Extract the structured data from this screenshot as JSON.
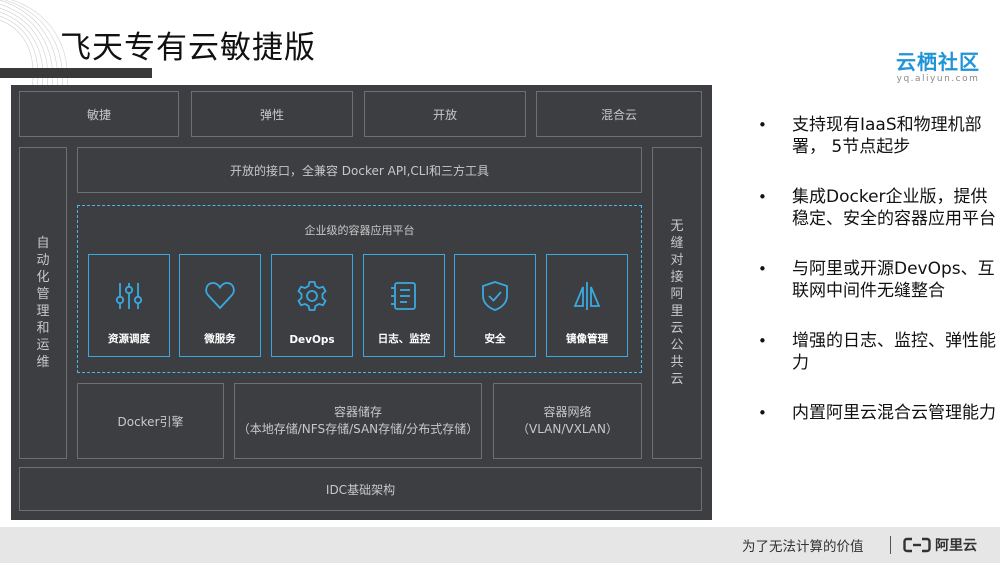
{
  "slide": {
    "title": "飞天专有云敏捷版",
    "logo_main": "云栖社区",
    "logo_sub": "yq.aliyun.com"
  },
  "diagram": {
    "top_row": [
      "敏捷",
      "弹性",
      "开放",
      "混合云"
    ],
    "left_side": "自动化管理和运维",
    "right_side": "无缝对接阿里云公共云",
    "api_bar": "开放的接口，全兼容 Docker API,CLI和三方工具",
    "platform": {
      "title": "企业级的容器应用平台",
      "modules": [
        {
          "label": "资源调度",
          "icon": "sliders-icon"
        },
        {
          "label": "微服务",
          "icon": "heart-icon"
        },
        {
          "label": "DevOps",
          "icon": "gear-icon"
        },
        {
          "label": "日志、监控",
          "icon": "log-icon"
        },
        {
          "label": "安全",
          "icon": "shield-icon"
        },
        {
          "label": "镜像管理",
          "icon": "mirror-icon"
        }
      ]
    },
    "engine": "Docker引擎",
    "storage_title": "容器储存",
    "storage_detail": "（本地存储/NFS存储/SAN存储/分布式存储）",
    "network_title": "容器网络",
    "network_detail": "（VLAN/VXLAN）",
    "base": "IDC基础架构"
  },
  "bullets": [
    "支持现有IaaS和物理机部署， 5节点起步",
    "集成Docker企业版，提供稳定、安全的容器应用平台",
    "与阿里或开源DevOps、互联网中间件无缝整合",
    "增强的日志、监控、弹性能力",
    "内置阿里云混合云管理能力"
  ],
  "footer": {
    "tagline": "为了无法计算的价值",
    "brand": "阿里云"
  },
  "colors": {
    "diagram_bg": "#3d3e41",
    "accent_blue": "#3aa9e0",
    "logo_blue": "#1f95d8"
  }
}
